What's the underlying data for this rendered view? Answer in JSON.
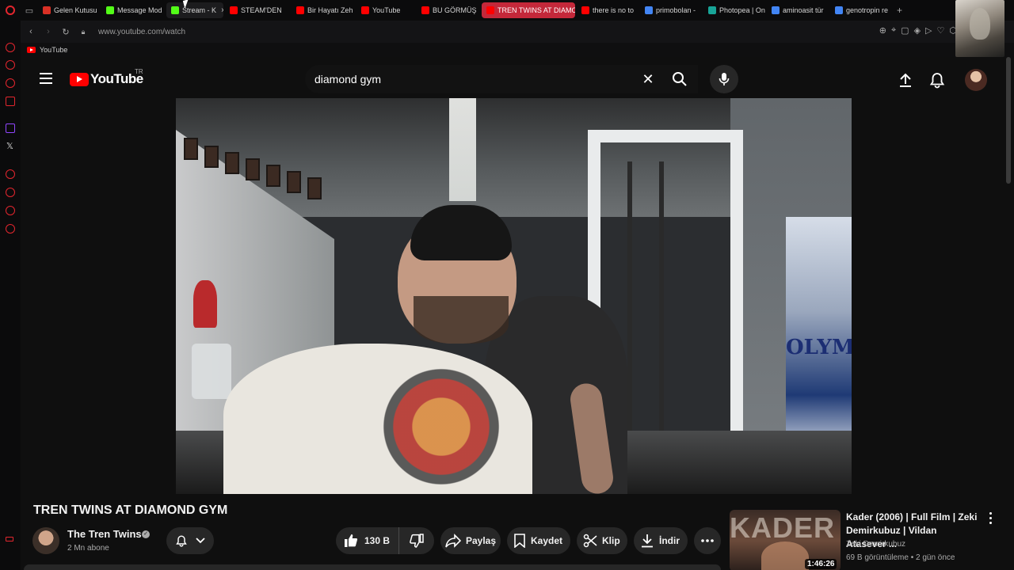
{
  "browser": {
    "tabs": [
      {
        "label": "Gelen Kutusu",
        "fav_color": "#d93025",
        "state": "normal"
      },
      {
        "label": "Message Mod",
        "fav_color": "#53fc18",
        "state": "normal"
      },
      {
        "label": "Stream - K",
        "fav_color": "#53fc18",
        "state": "hover"
      },
      {
        "label": "STEAM'DEN",
        "fav_color": "#ff0000",
        "state": "normal"
      },
      {
        "label": "Bir Hayatı Zeh",
        "fav_color": "#ff0000",
        "state": "normal"
      },
      {
        "label": "YouTube",
        "fav_color": "#ff0000",
        "state": "normal"
      },
      {
        "label": "BU GÖRMÜŞ",
        "fav_color": "#ff0000",
        "state": "normal"
      },
      {
        "label": "TREN TWINS AT DIAMO",
        "fav_color": "#ff0000",
        "state": "active"
      },
      {
        "label": "there is no to",
        "fav_color": "#ff0000",
        "state": "normal"
      },
      {
        "label": "primobolan -",
        "fav_color": "#4285f4",
        "state": "normal"
      },
      {
        "label": "Photopea | On",
        "fav_color": "#18a497",
        "state": "normal"
      },
      {
        "label": "aminoasit tür",
        "fav_color": "#4285f4",
        "state": "normal"
      },
      {
        "label": "genotropin re",
        "fav_color": "#4285f4",
        "state": "normal"
      }
    ],
    "tab_close_glyph": "×",
    "new_tab_glyph": "+",
    "url": "www.youtube.com/watch",
    "bookmark_label": "YouTube"
  },
  "masthead": {
    "logo_text": "YouTube",
    "country_code": "TR",
    "search_query": "diamond gym",
    "clear_glyph": "✕"
  },
  "video": {
    "title": "TREN TWINS AT DIAMOND GYM",
    "poster_text": "OLYM",
    "channel": {
      "name": "The Tren Twins",
      "subscribers": "2 Mn abone"
    },
    "actions": {
      "likes": "130 B",
      "share": "Paylaş",
      "save": "Kaydet",
      "clip": "Klip",
      "download": "İndir"
    }
  },
  "recommendation": {
    "title": "Kader (2006) | Full Film | Zeki Demirkubuz | Vildan Atasever ...",
    "channel": "Zeki Demirkubuz",
    "meta": "69 B görüntüleme • 2 gün önce",
    "duration": "1:46:26",
    "thumb_word": "KADER"
  },
  "colors": {
    "accent": "#ff0000",
    "active_tab": "#c4283a",
    "background": "#0f0f0f",
    "pill": "#272727"
  }
}
